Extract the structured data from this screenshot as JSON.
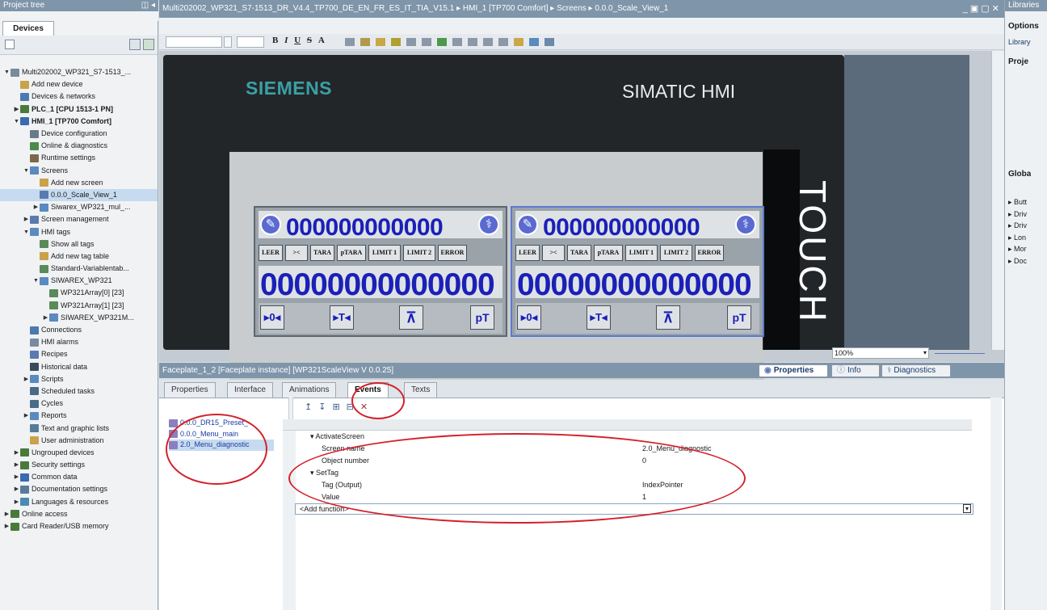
{
  "left_panel": {
    "title": "Project tree",
    "tab": "Devices",
    "items": [
      {
        "label": "Multi202002_WP321_S7-1513_...",
        "indent": 0,
        "arrow": "down",
        "icon": "doc",
        "color": "#7a8a9a",
        "bold": false
      },
      {
        "label": "Add new device",
        "indent": 1,
        "arrow": "",
        "icon": "add",
        "color": "#c9a24a",
        "bold": false
      },
      {
        "label": "Devices & networks",
        "indent": 1,
        "arrow": "",
        "icon": "net",
        "color": "#4a7ab0",
        "bold": false
      },
      {
        "label": "PLC_1 [CPU 1513-1 PN]",
        "indent": 1,
        "arrow": "right",
        "icon": "plc",
        "color": "#4a7a3a",
        "bold": true
      },
      {
        "label": "HMI_1 [TP700 Comfort]",
        "indent": 1,
        "arrow": "down",
        "icon": "hmi",
        "color": "#3a6ab0",
        "bold": true
      },
      {
        "label": "Device configuration",
        "indent": 2,
        "arrow": "",
        "icon": "cfg",
        "color": "#6a7a8a",
        "bold": false
      },
      {
        "label": "Online & diagnostics",
        "indent": 2,
        "arrow": "",
        "icon": "diag",
        "color": "#4a8a4a",
        "bold": false
      },
      {
        "label": "Runtime settings",
        "indent": 2,
        "arrow": "",
        "icon": "rt",
        "color": "#7a6a4a",
        "bold": false
      },
      {
        "label": "Screens",
        "indent": 2,
        "arrow": "down",
        "icon": "folder",
        "color": "#5a8ac0",
        "bold": false
      },
      {
        "label": "Add new screen",
        "indent": 3,
        "arrow": "",
        "icon": "add",
        "color": "#c9a24a",
        "bold": false
      },
      {
        "label": "0.0.0_Scale_View_1",
        "indent": 3,
        "arrow": "",
        "icon": "screen",
        "color": "#5a7ab0",
        "bold": false,
        "selected": true
      },
      {
        "label": "Siwarex_WP321_mul_...",
        "indent": 3,
        "arrow": "right",
        "icon": "folder",
        "color": "#5a8ac0",
        "bold": false
      },
      {
        "label": "Screen management",
        "indent": 2,
        "arrow": "right",
        "icon": "mgmt",
        "color": "#5a7ab0",
        "bold": false
      },
      {
        "label": "HMI tags",
        "indent": 2,
        "arrow": "down",
        "icon": "folder",
        "color": "#5a8ac0",
        "bold": false
      },
      {
        "label": "Show all tags",
        "indent": 3,
        "arrow": "",
        "icon": "tags",
        "color": "#5a8a5a",
        "bold": false
      },
      {
        "label": "Add new tag table",
        "indent": 3,
        "arrow": "",
        "icon": "add",
        "color": "#c9a24a",
        "bold": false
      },
      {
        "label": "Standard-Variablentab...",
        "indent": 3,
        "arrow": "",
        "icon": "tags",
        "color": "#5a8a5a",
        "bold": false
      },
      {
        "label": "SIWAREX_WP321",
        "indent": 3,
        "arrow": "down",
        "icon": "folder",
        "color": "#5a8ac0",
        "bold": false
      },
      {
        "label": "WP321Array[0] [23]",
        "indent": 4,
        "arrow": "",
        "icon": "tags",
        "color": "#5a8a5a",
        "bold": false
      },
      {
        "label": "WP321Array[1] [23]",
        "indent": 4,
        "arrow": "",
        "icon": "tags",
        "color": "#5a8a5a",
        "bold": false
      },
      {
        "label": "SIWAREX_WP321M...",
        "indent": 4,
        "arrow": "right",
        "icon": "folder",
        "color": "#5a8ac0",
        "bold": false
      },
      {
        "label": "Connections",
        "indent": 2,
        "arrow": "",
        "icon": "conn",
        "color": "#4a7ab0",
        "bold": false
      },
      {
        "label": "HMI alarms",
        "indent": 2,
        "arrow": "",
        "icon": "alarm",
        "color": "#7a8aa0",
        "bold": false
      },
      {
        "label": "Recipes",
        "indent": 2,
        "arrow": "",
        "icon": "recipe",
        "color": "#5a7ab0",
        "bold": false
      },
      {
        "label": "Historical data",
        "indent": 2,
        "arrow": "",
        "icon": "hist",
        "color": "#3a4a5a",
        "bold": false
      },
      {
        "label": "Scripts",
        "indent": 2,
        "arrow": "right",
        "icon": "folder",
        "color": "#5a8ac0",
        "bold": false
      },
      {
        "label": "Scheduled tasks",
        "indent": 2,
        "arrow": "",
        "icon": "task",
        "color": "#4a6a8a",
        "bold": false
      },
      {
        "label": "Cycles",
        "indent": 2,
        "arrow": "",
        "icon": "cycle",
        "color": "#4a6a8a",
        "bold": false
      },
      {
        "label": "Reports",
        "indent": 2,
        "arrow": "right",
        "icon": "folder",
        "color": "#5a8ac0",
        "bold": false
      },
      {
        "label": "Text and graphic lists",
        "indent": 2,
        "arrow": "",
        "icon": "list",
        "color": "#5a7a9a",
        "bold": false
      },
      {
        "label": "User administration",
        "indent": 2,
        "arrow": "",
        "icon": "user",
        "color": "#c9a24a",
        "bold": false
      },
      {
        "label": "Ungrouped devices",
        "indent": 1,
        "arrow": "right",
        "icon": "folder",
        "color": "#4a7a3a",
        "bold": false
      },
      {
        "label": "Security settings",
        "indent": 1,
        "arrow": "right",
        "icon": "sec",
        "color": "#4a7a3a",
        "bold": false
      },
      {
        "label": "Common data",
        "indent": 1,
        "arrow": "right",
        "icon": "common",
        "color": "#3a6ab0",
        "bold": false
      },
      {
        "label": "Documentation settings",
        "indent": 1,
        "arrow": "right",
        "icon": "docs",
        "color": "#5a7a9a",
        "bold": false
      },
      {
        "label": "Languages & resources",
        "indent": 1,
        "arrow": "right",
        "icon": "lang",
        "color": "#4a8ab0",
        "bold": false
      },
      {
        "label": "Online access",
        "indent": 0,
        "arrow": "right",
        "icon": "online",
        "color": "#4a7a3a",
        "bold": false
      },
      {
        "label": "Card Reader/USB memory",
        "indent": 0,
        "arrow": "right",
        "icon": "usb",
        "color": "#4a7a3a",
        "bold": false
      }
    ]
  },
  "title_bar": {
    "breadcrumb": "Multi202002_WP321_S7-1513_DR_V4.4_TP700_DE_EN_FR_ES_IT_TIA_V15.1  ▸  HMI_1 [TP700 Comfort]  ▸  Screens  ▸  0.0.0_Scale_View_1",
    "window_controls": "_ ▣ ▢ ✕"
  },
  "toolbar": {
    "font_buttons": [
      "B",
      "I",
      "U",
      "S",
      "A"
    ]
  },
  "hmi": {
    "brand": "SIEMENS",
    "product": "SIMATIC HMI",
    "touch_label": "TOUCH",
    "faceplate_top_value": "000000000000",
    "faceplate_main_value": "00000000000000",
    "buttons": [
      "LEER",
      "><",
      "TARA",
      "pTARA",
      "LIMIT 1",
      "LIMIT 2",
      "ERROR"
    ],
    "symbols": [
      "▸0◂",
      "▸T◂",
      "⊼",
      "pT"
    ]
  },
  "zoom": {
    "value": "100%"
  },
  "bottom_panel": {
    "title": "Faceplate_1_2 [Faceplate instance] [WP321ScaleView V 0.0.25]",
    "inspector_tabs": [
      "Properties",
      "Info",
      "Diagnostics"
    ],
    "tabs": [
      "Properties",
      "Interface",
      "Animations",
      "Events",
      "Texts"
    ],
    "screens": [
      "0.0.0_DR15_Preset_",
      "0.0.0_Menu_main",
      "2.0_Menu_diagnostic"
    ],
    "rows": [
      {
        "c1": "▾ ActivateScreen",
        "c2": "",
        "ind": 0
      },
      {
        "c1": "Screen name",
        "c2": "2.0_Menu_diagnostic",
        "ind": 1
      },
      {
        "c1": "Object number",
        "c2": "0",
        "ind": 1
      },
      {
        "c1": "▾ SetTag",
        "c2": "",
        "ind": 0
      },
      {
        "c1": "Tag (Output)",
        "c2": "IndexPointer",
        "ind": 1
      },
      {
        "c1": "Value",
        "c2": "1",
        "ind": 1
      }
    ],
    "add_function": "<Add function>"
  },
  "right_panel": {
    "title": "Libraries",
    "options": "Options",
    "library_view": "Library",
    "project": "Proje",
    "global": "Globa",
    "global_items": [
      "Butt",
      "Driv",
      "Driv",
      "Lon",
      "Mor",
      "Doc"
    ]
  },
  "accent": {
    "siemens": "#3aa0a6",
    "digits": "#1a20b8",
    "annotation": "#d4202a"
  }
}
